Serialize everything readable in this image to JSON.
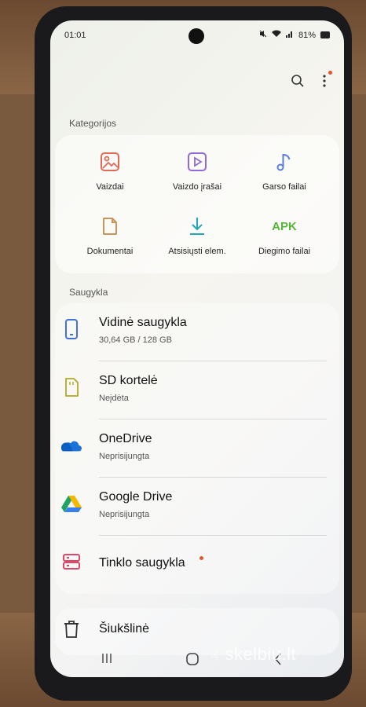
{
  "status_bar": {
    "time": "01:01",
    "battery": "81%",
    "icons": [
      "mute-icon",
      "wifi-icon",
      "signal-icon",
      "battery-icon"
    ]
  },
  "toolbar": {
    "icons": [
      "search-icon",
      "more-options-icon"
    ]
  },
  "categories": {
    "title": "Kategorijos",
    "items": [
      {
        "label": "Vaizdai",
        "icon": "image-icon"
      },
      {
        "label": "Vaizdo įrašai",
        "icon": "video-icon"
      },
      {
        "label": "Garso failai",
        "icon": "music-note-icon"
      },
      {
        "label": "Dokumentai",
        "icon": "document-icon"
      },
      {
        "label": "Atsisiųsti elem.",
        "icon": "download-icon"
      },
      {
        "label": "Diegimo failai",
        "icon_text": "APK"
      }
    ]
  },
  "storage": {
    "title": "Saugykla",
    "items": [
      {
        "title": "Vidinė saugykla",
        "subtitle": "30,64 GB / 128 GB",
        "icon": "phone-storage-icon"
      },
      {
        "title": "SD kortelė",
        "subtitle": "Neįdėta",
        "icon": "sd-card-icon"
      },
      {
        "title": "OneDrive",
        "subtitle": "Neprisijungta",
        "icon": "onedrive-icon"
      },
      {
        "title": "Google Drive",
        "subtitle": "Neprisijungta",
        "icon": "google-drive-icon"
      },
      {
        "title": "Tinklo saugykla",
        "subtitle": "",
        "icon": "network-storage-icon"
      }
    ]
  },
  "trash": {
    "title": "Šiukšlinė",
    "icon": "trash-icon"
  },
  "nav": {
    "icons": [
      "recent-apps-icon",
      "home-icon",
      "back-icon"
    ]
  },
  "watermark": "skelbiu.lt",
  "colors": {
    "accent_red": "#e8542c",
    "apk_green": "#55b63a",
    "image_icon": "#e06a55",
    "video_icon": "#8f6ad8",
    "music_icon": "#5a7de0",
    "doc_icon": "#c8955a",
    "download_icon": "#22a7b7"
  }
}
